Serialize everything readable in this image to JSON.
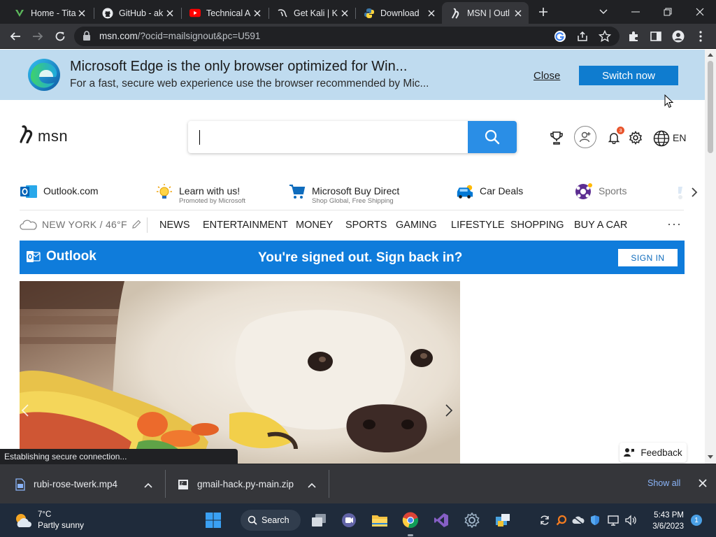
{
  "browser": {
    "tabs": [
      {
        "title": "Home - Tita",
        "icon": "rust-logo-icon"
      },
      {
        "title": "GitHub - ak",
        "icon": "github-icon"
      },
      {
        "title": "Technical A",
        "icon": "youtube-icon"
      },
      {
        "title": "Get Kali | K",
        "icon": "kali-dragon-icon"
      },
      {
        "title": "Download",
        "icon": "python-icon"
      },
      {
        "title": "MSN | Outl",
        "icon": "msn-icon"
      }
    ],
    "url_host": "msn.com",
    "url_path": "/?ocid=mailsignout&pc=U591",
    "status_text": "Establishing secure connection..."
  },
  "edge_banner": {
    "title": "Microsoft Edge is the only browser optimized for Win...",
    "subtitle": "For a fast, secure web experience use the browser recommended by Mic...",
    "close_label": "Close",
    "switch_label": "Switch now"
  },
  "msn": {
    "logo_text": "msn",
    "notification_count": "3",
    "language": "EN",
    "quick_links": [
      {
        "label": "Outlook.com",
        "sub": ""
      },
      {
        "label": "Learn with us!",
        "sub": "Promoted by Microsoft"
      },
      {
        "label": "Microsoft Buy Direct",
        "sub": "Shop Global, Free Shipping"
      },
      {
        "label": "Car Deals",
        "sub": ""
      },
      {
        "label": "Sports",
        "sub": ""
      }
    ],
    "weather_chip": "NEW YORK / 46°F",
    "nav": [
      "NEWS",
      "ENTERTAINMENT",
      "MONEY",
      "SPORTS",
      "GAMING",
      "LIFESTYLE",
      "SHOPPING",
      "BUY A CAR"
    ],
    "more": "···",
    "outlook_bar": {
      "brand": "Outlook",
      "message": "You're signed out. Sign back in?",
      "signin_label": "SIGN IN"
    },
    "feedback_label": "Feedback"
  },
  "downloads": {
    "items": [
      {
        "name": "rubi-rose-twerk.mp4"
      },
      {
        "name": "gmail-hack.py-main.zip"
      }
    ],
    "show_all": "Show all"
  },
  "taskbar": {
    "weather_temp": "7°C",
    "weather_cond": "Partly sunny",
    "search_label": "Search",
    "time": "5:43 PM",
    "date": "3/6/2023",
    "notifications": "1"
  },
  "colors": {
    "edge_banner_bg": "#bfdbef",
    "switch_button": "#0f7ccf",
    "outlook_bar": "#0f7cdb",
    "search_button": "#2a8ee6"
  }
}
